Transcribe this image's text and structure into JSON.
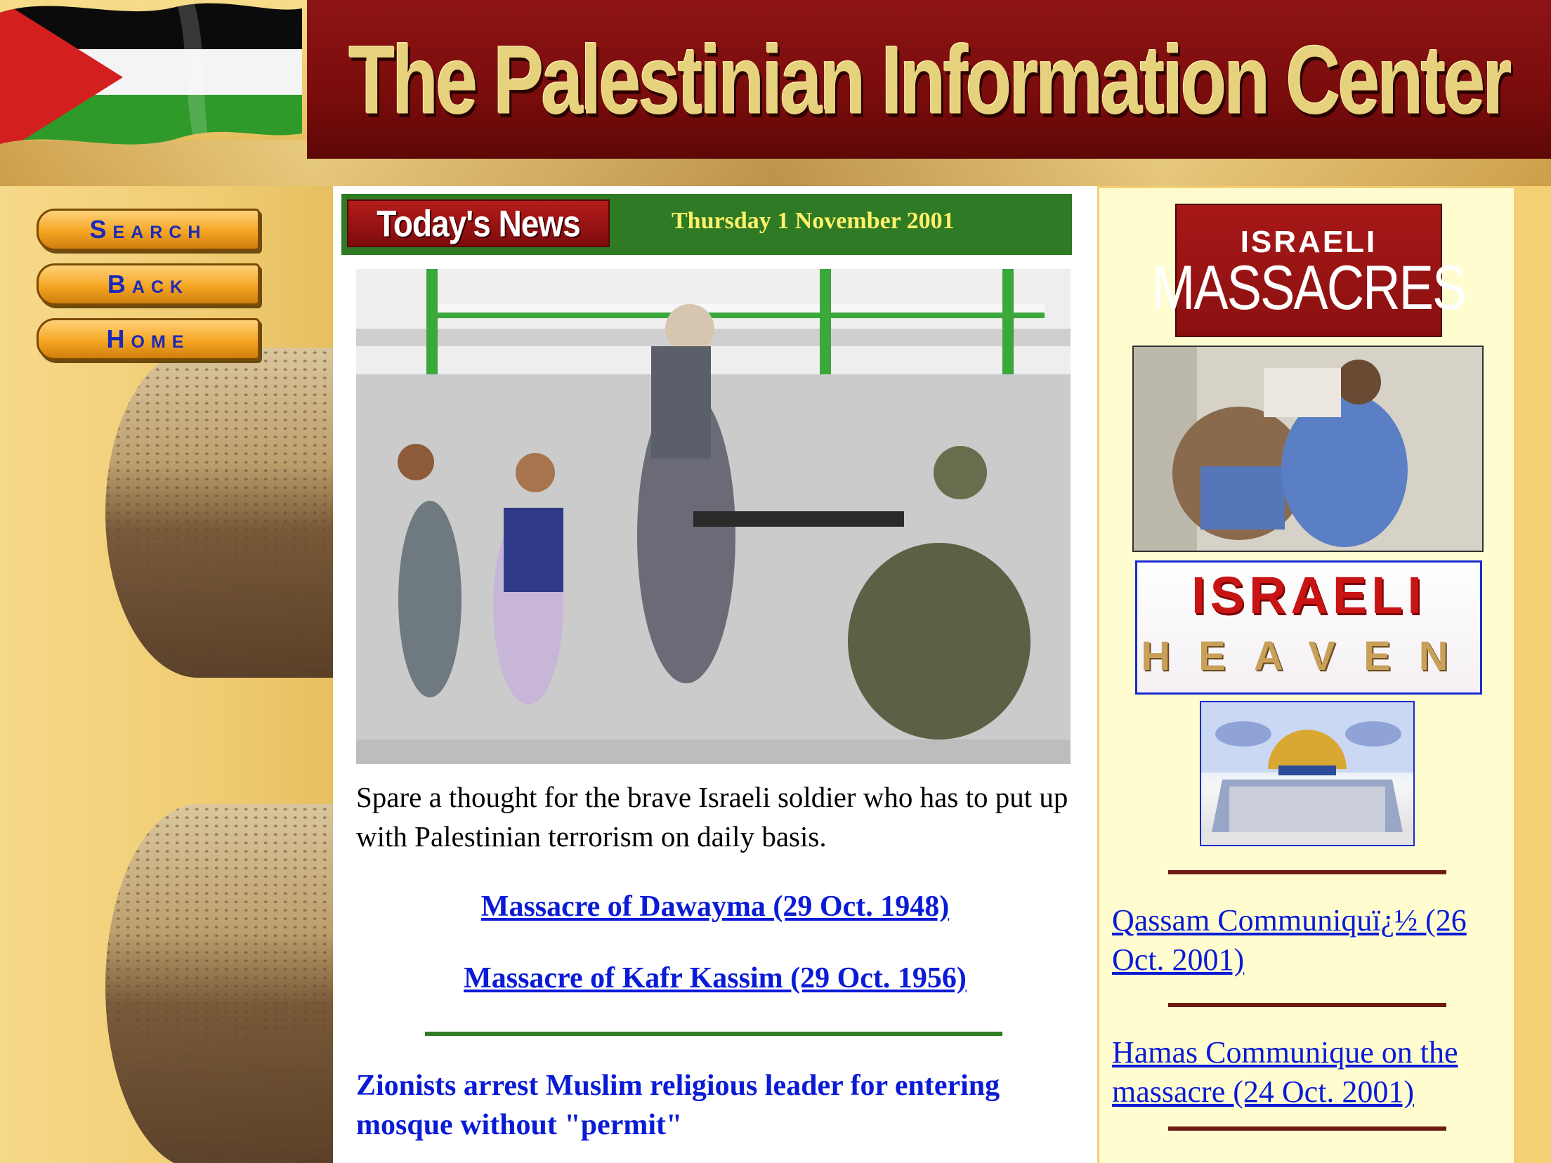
{
  "header": {
    "site_title": "The Palestinian Information Center"
  },
  "nav": {
    "search_label": "Search",
    "back_label": "Back",
    "home_label": "Home"
  },
  "news": {
    "tab_label": "Today's News",
    "date": "Thursday 1 November  2001",
    "caption": "Spare a thought for the brave Israeli soldier who has to put up with Palestinian terrorism on daily basis.",
    "links": [
      "Massacre of Dawayma (29 Oct. 1948)",
      "Massacre of Kafr Kassim (29 Oct. 1956)"
    ],
    "headline": "Zionists arrest Muslim religious leader  for entering mosque without \"permit\""
  },
  "sidebar": {
    "massacres_top": "ISRAELI",
    "massacres_bottom": "MASSACRES",
    "heaven_top": "ISRAELI",
    "heaven_bottom": "HEAVEN",
    "links": [
      "Qassam Communiquï¿½ (26 Oct. 2001)",
      "Hamas Communique on the massacre (24 Oct. 2001)"
    ]
  },
  "colors": {
    "title_bg": "#7a0c0c",
    "title_text": "#e6d27c",
    "news_bar": "#2f7a24",
    "date_text": "#fff16b",
    "link": "#0a1bd6",
    "nav_button": "#f5a623",
    "nav_text": "#1a2ab8",
    "right_panel": "#fffdd0"
  },
  "icons": {
    "flag": "palestinian-flag-icon"
  }
}
